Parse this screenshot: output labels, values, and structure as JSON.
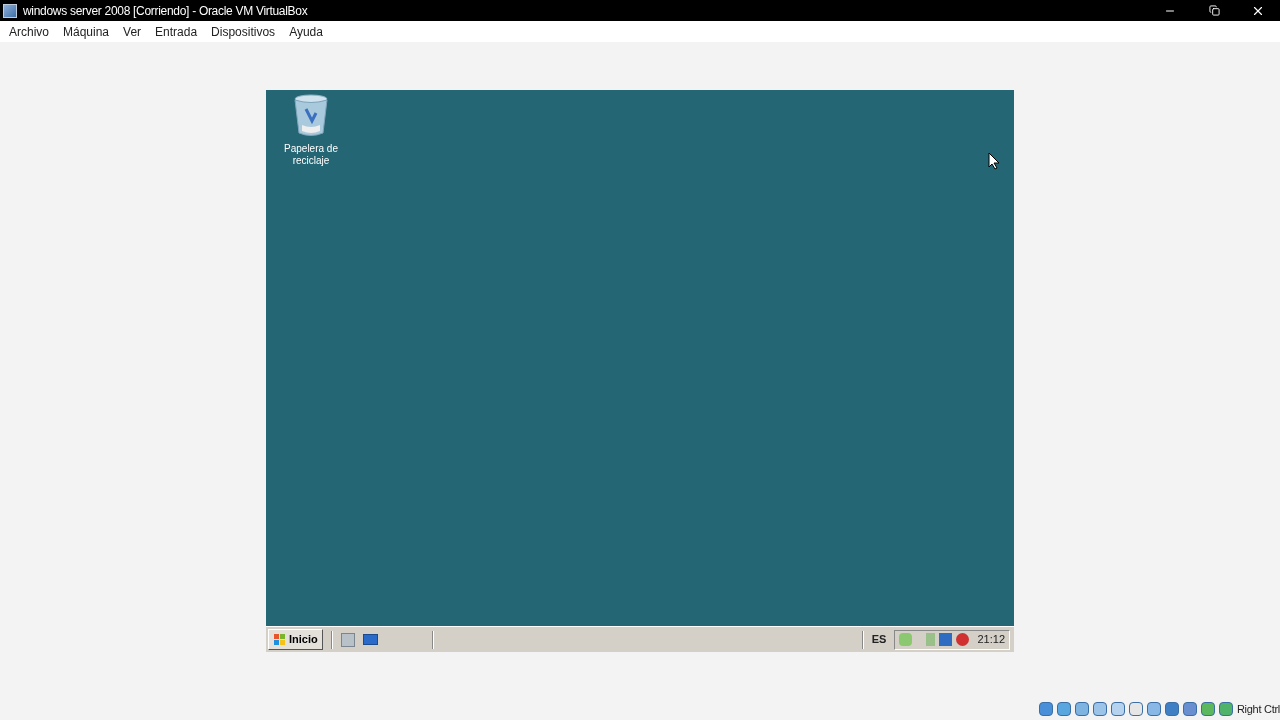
{
  "window": {
    "title": "windows server 2008 [Corriendo] - Oracle VM VirtualBox"
  },
  "menu": [
    "Archivo",
    "Máquina",
    "Ver",
    "Entrada",
    "Dispositivos",
    "Ayuda"
  ],
  "desktop": {
    "icons": [
      {
        "label": "Papelera de reciclaje"
      }
    ]
  },
  "taskbar": {
    "start": "Inicio",
    "language": "ES",
    "clock": "21:12"
  },
  "status_bar": {
    "host_key": "Right Ctrl"
  }
}
